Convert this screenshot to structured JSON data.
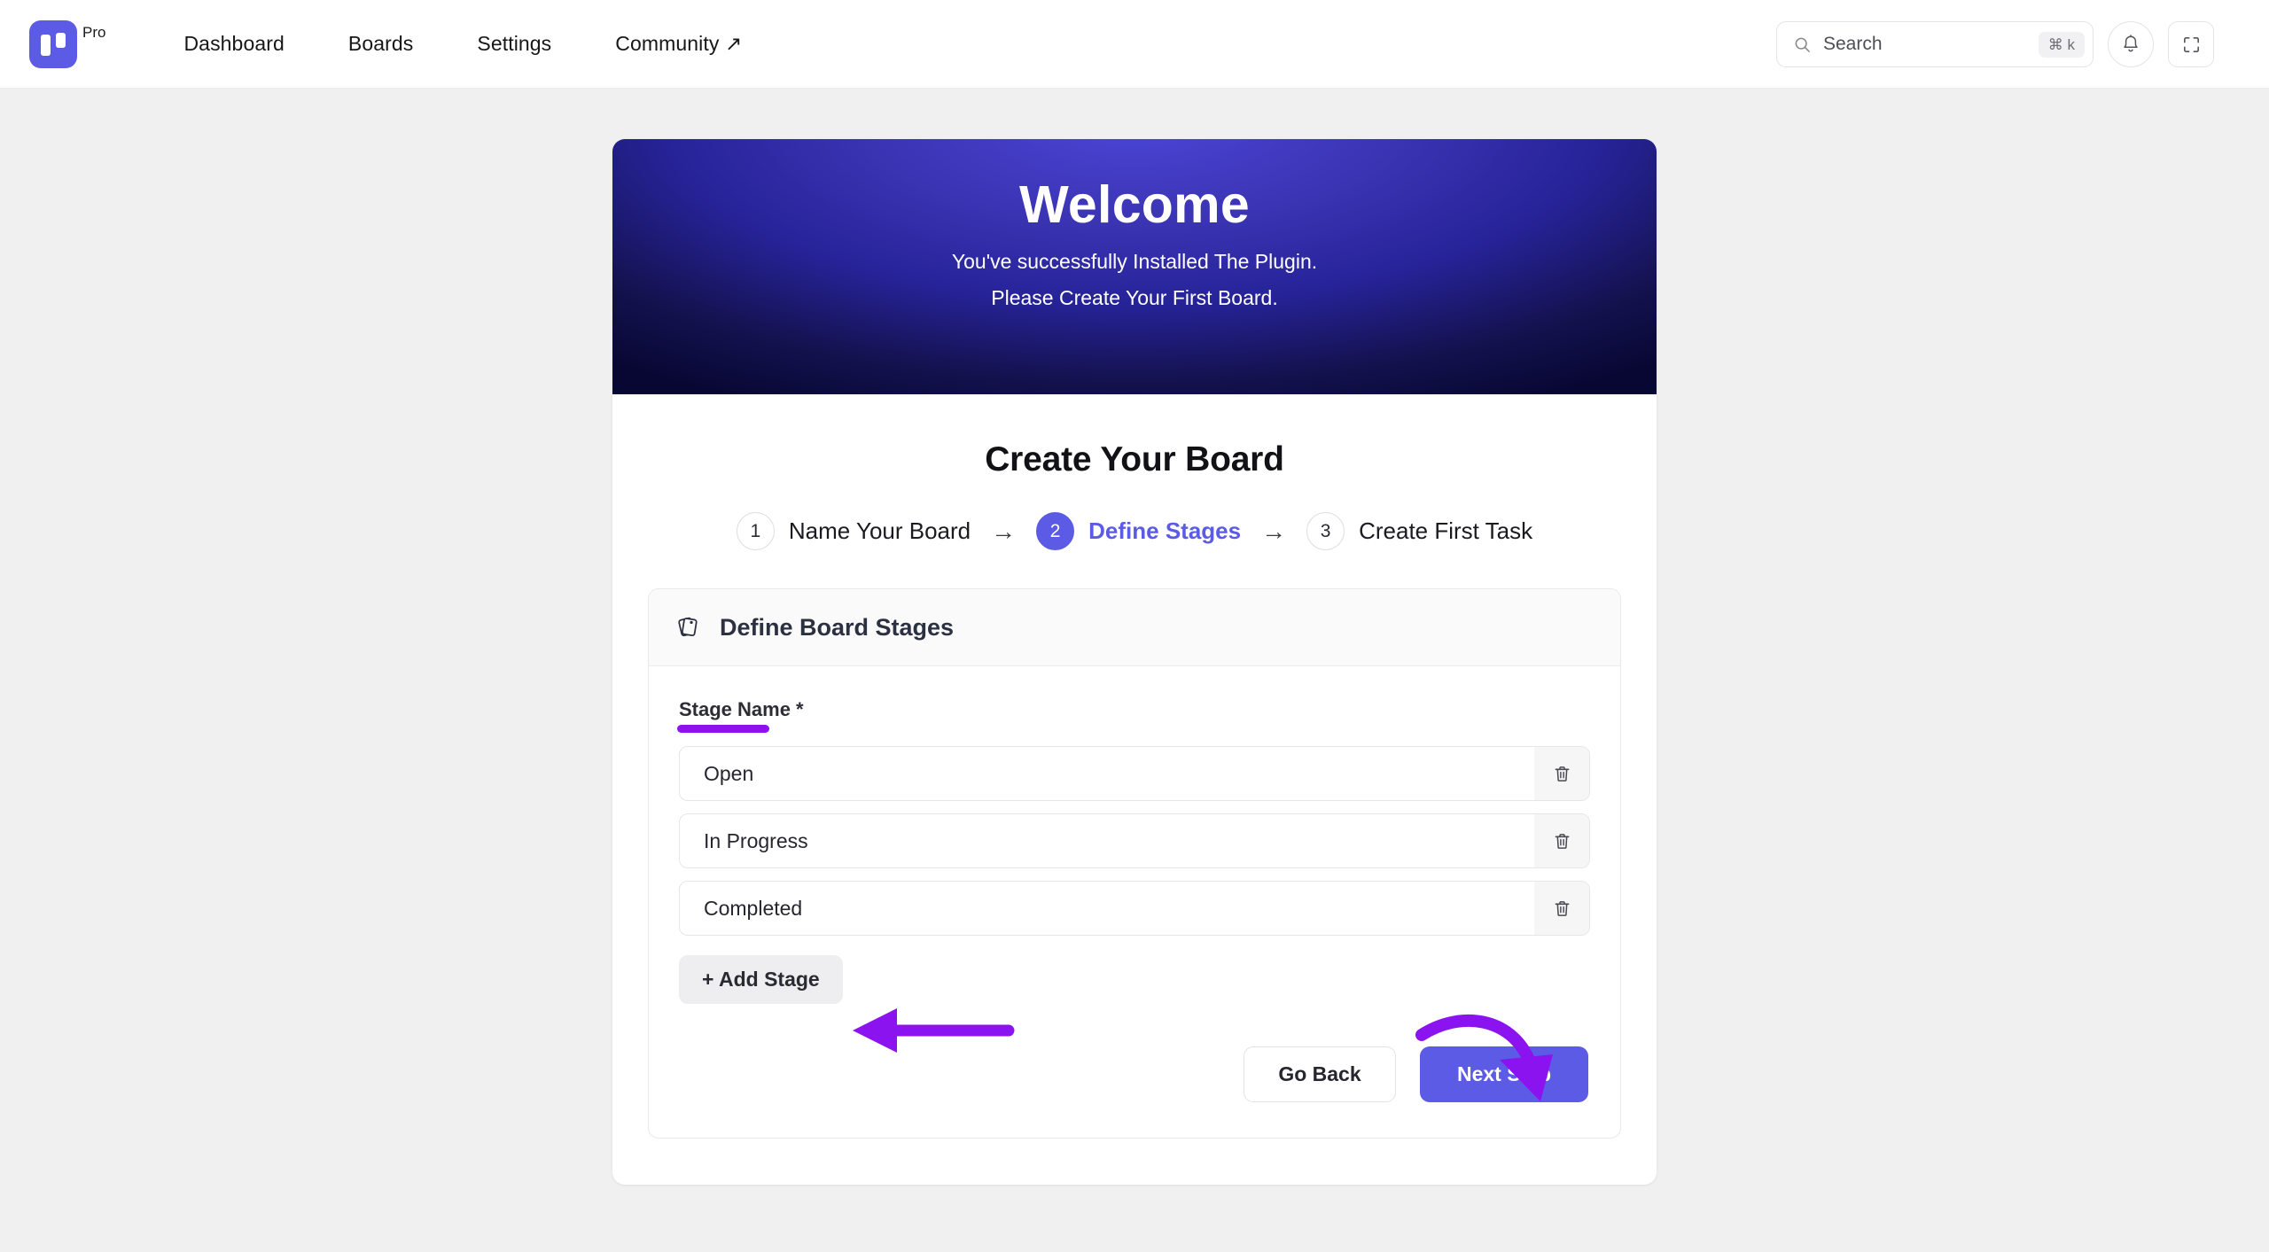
{
  "nav": {
    "brand_tag": "Pro",
    "logo_icon": "app-logo-icon",
    "links": [
      {
        "label": "Dashboard",
        "external": false
      },
      {
        "label": "Boards",
        "external": false
      },
      {
        "label": "Settings",
        "external": false
      },
      {
        "label": "Community ↗",
        "external": true
      }
    ],
    "search": {
      "placeholder": "Search",
      "shortcut": "⌘ k",
      "icon": "search-icon"
    },
    "notifications_icon": "bell-icon",
    "fullscreen_icon": "expand-icon"
  },
  "banner": {
    "title": "Welcome",
    "line1": "You've successfully Installed The Plugin.",
    "line2": "Please Create Your First Board."
  },
  "main": {
    "page_title": "Create Your Board",
    "steps": [
      {
        "number": "1",
        "label": "Name Your Board",
        "active": false
      },
      {
        "number": "2",
        "label": "Define Stages",
        "active": true
      },
      {
        "number": "3",
        "label": "Create First Task",
        "active": false
      }
    ],
    "step_separator": "→",
    "card": {
      "icon": "cards-stack-icon",
      "title": "Define Board Stages",
      "field_label": "Stage Name *",
      "stages": [
        {
          "value": "Open",
          "delete_icon": "trash-icon"
        },
        {
          "value": "In Progress",
          "delete_icon": "trash-icon"
        },
        {
          "value": "Completed",
          "delete_icon": "trash-icon"
        }
      ],
      "add_stage_label": "+ Add Stage",
      "go_back_label": "Go Back",
      "next_step_label": "Next Step"
    }
  },
  "annotations": {
    "underline_color": "#8b13f0",
    "arrow_color": "#8b13f0",
    "straight_arrow_target": "+ Add Stage",
    "curved_arrow_target": "Next Step"
  },
  "colors": {
    "brand_purple": "#5b5be6",
    "annotation_purple": "#8b13f0",
    "page_background": "#f0f0f0",
    "banner_top": "#4b46d8",
    "banner_bottom": "#080733"
  }
}
